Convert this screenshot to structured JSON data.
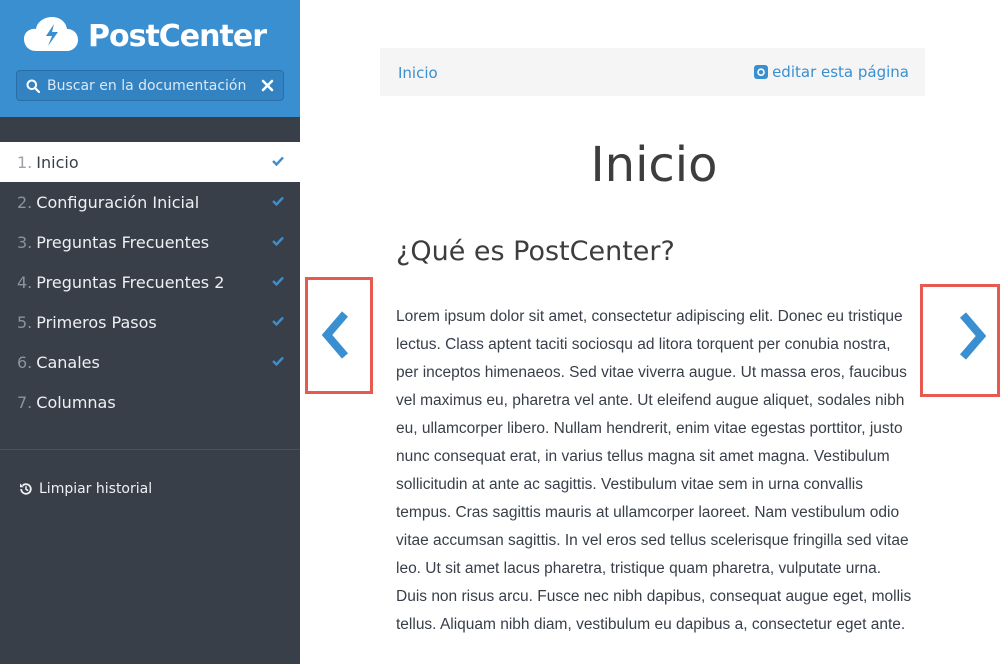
{
  "app": {
    "brand": "PostCenter",
    "accent_color": "#3a8fd0",
    "sidebar_color": "#383f49"
  },
  "search": {
    "placeholder": "Buscar en la documentación",
    "icon": "search-icon",
    "clear_icon": "close-icon"
  },
  "nav": {
    "items": [
      {
        "num": "1.",
        "label": "Inicio",
        "active": true,
        "checked": true
      },
      {
        "num": "2.",
        "label": "Configuración Inicial",
        "active": false,
        "checked": true
      },
      {
        "num": "3.",
        "label": "Preguntas Frecuentes",
        "active": false,
        "checked": true
      },
      {
        "num": "4.",
        "label": "Preguntas Frecuentes 2",
        "active": false,
        "checked": true
      },
      {
        "num": "5.",
        "label": "Primeros Pasos",
        "active": false,
        "checked": true
      },
      {
        "num": "6.",
        "label": "Canales",
        "active": false,
        "checked": true
      },
      {
        "num": "7.",
        "label": "Columnas",
        "active": false,
        "checked": false
      }
    ]
  },
  "history": {
    "label": "Limpiar historial",
    "icon": "history-icon"
  },
  "topbar": {
    "breadcrumb": "Inicio",
    "edit_label": "editar esta página",
    "edit_icon": "github-icon"
  },
  "content": {
    "title": "Inicio",
    "section_title": "¿Qué es PostCenter?",
    "paragraph": "Lorem ipsum dolor sit amet, consectetur adipiscing elit. Donec eu tristique lectus. Class aptent taciti sociosqu ad litora torquent per conubia nostra, per inceptos himenaeos. Sed vitae viverra augue. Ut massa eros, faucibus vel maximus eu, pharetra vel ante. Ut eleifend augue aliquet, sodales nibh eu, ullamcorper libero. Nullam hendrerit, enim vitae egestas porttitor, justo nunc consequat erat, in varius tellus magna sit amet magna. Vestibulum sollicitudin at ante ac sagittis. Vestibulum vitae sem in urna convallis tempus. Cras sagittis mauris at ullamcorper laoreet. Nam vestibulum odio vitae accumsan sagittis. In vel eros sed tellus scelerisque fringilla sed vitae leo. Ut sit amet lacus pharetra, tristique quam pharetra, vulputate urna. Duis non risus arcu. Fusce nec nibh dapibus, consequat augue eget, mollis tellus. Aliquam nibh diam, vestibulum eu dapibus a, consectetur eget ante."
  },
  "arrows": {
    "prev_icon": "chevron-left-icon",
    "next_icon": "chevron-right-icon",
    "highlight_color": "#e85a4f"
  }
}
